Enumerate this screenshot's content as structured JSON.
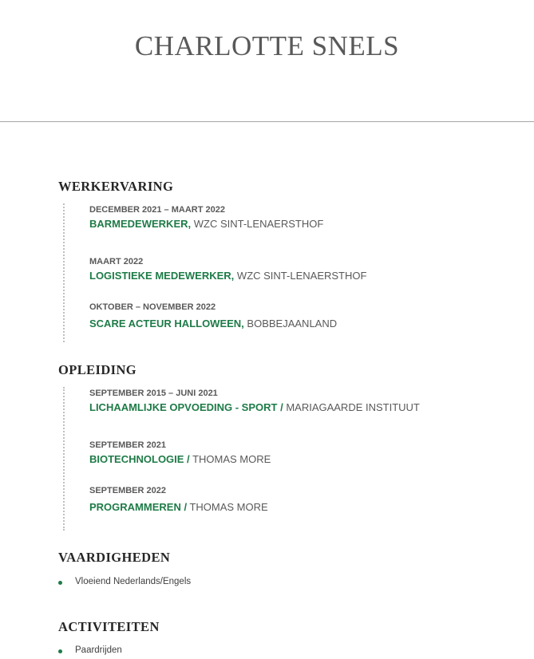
{
  "header": {
    "name": "CHARLOTTE SNELS"
  },
  "sections": {
    "work": {
      "title": "WERKERVARING",
      "entries": [
        {
          "date": "DECEMBER 2021 – MAART 2022",
          "title": "BARMEDEWERKER,",
          "org": "WZC SINT-LENAERSTHOF"
        },
        {
          "date": "MAART 2022",
          "title": "LOGISTIEKE MEDEWERKER,",
          "org": "WZC SINT-LENAERSTHOF"
        },
        {
          "date": "OKTOBER – NOVEMBER 2022",
          "title": "SCARE ACTEUR HALLOWEEN,",
          "org": "BOBBEJAANLAND"
        }
      ]
    },
    "education": {
      "title": "OPLEIDING",
      "entries": [
        {
          "date": "SEPTEMBER 2015 – JUNI 2021",
          "title": "LICHAAMLIJKE OPVOEDING - SPORT /",
          "org": "MARIAGAARDE INSTITUUT"
        },
        {
          "date": "SEPTEMBER 2021",
          "title": "BIOTECHNOLOGIE /",
          "org": "THOMAS MORE"
        },
        {
          "date": "SEPTEMBER 2022",
          "title": "PROGRAMMEREN /",
          "org": "THOMAS MORE"
        }
      ]
    },
    "skills": {
      "title": "VAARDIGHEDEN",
      "items": [
        "Vloeiend Nederlands/Engels"
      ]
    },
    "activities": {
      "title": "ACTIVITEITEN",
      "items": [
        "Paardrijden"
      ]
    }
  },
  "colors": {
    "accent": "#1e7b47",
    "text": "#595959",
    "heading": "#262626"
  }
}
